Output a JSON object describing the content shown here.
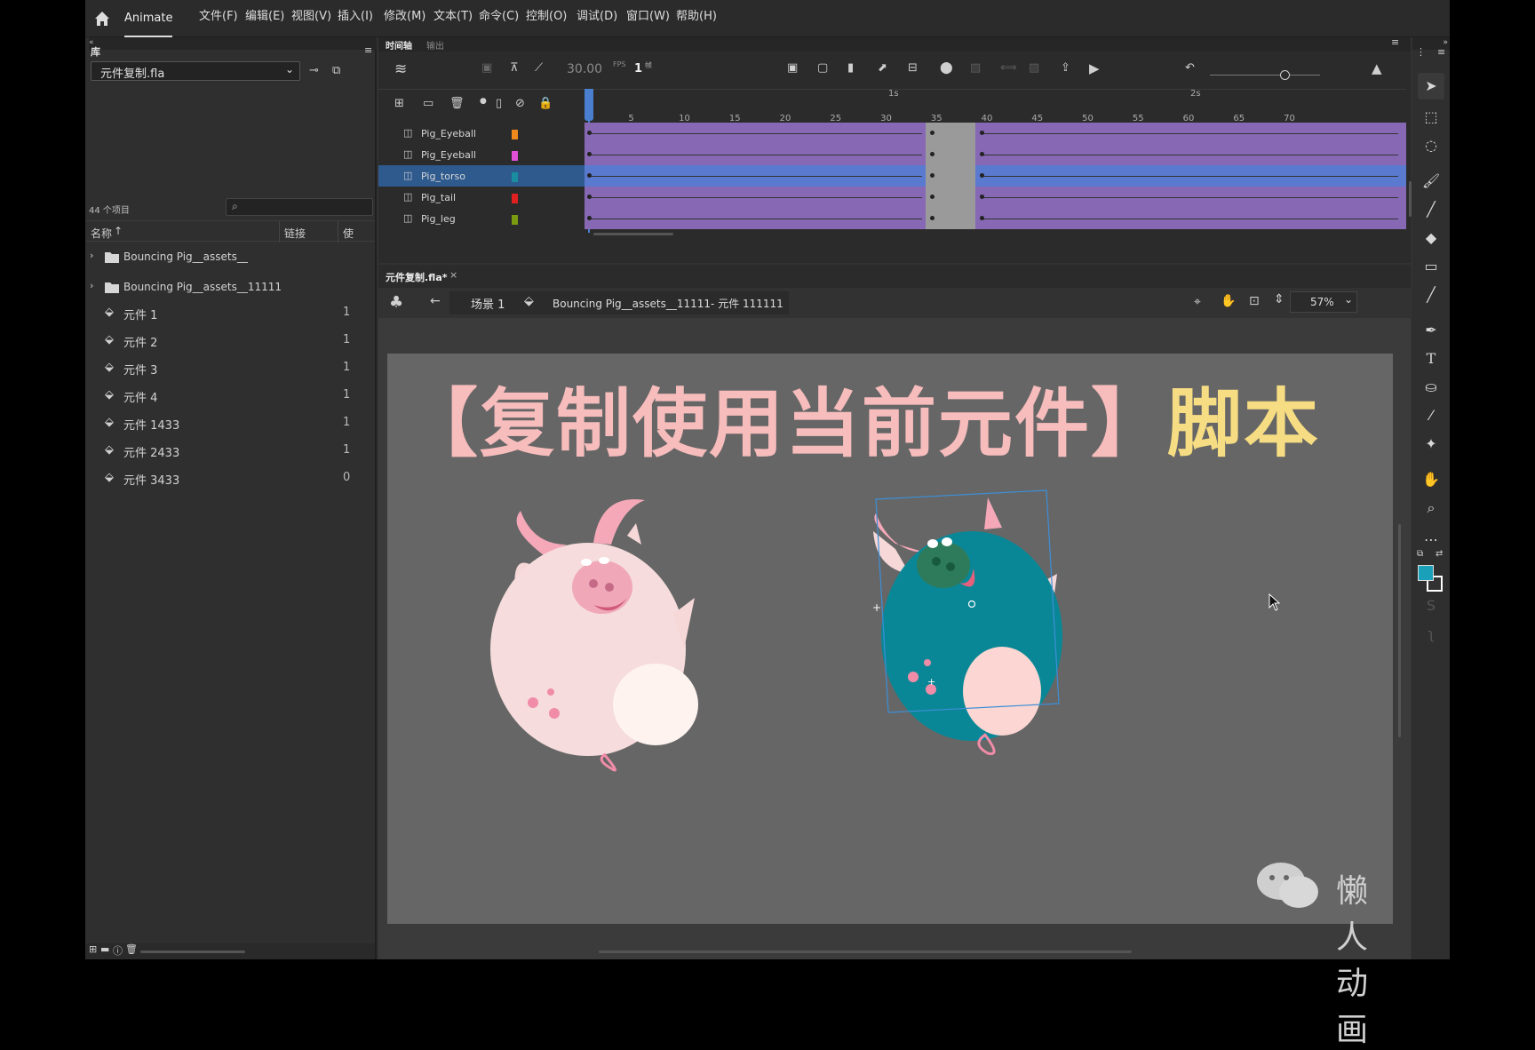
{
  "app": {
    "name": "Animate"
  },
  "menu": [
    "文件(F)",
    "编辑(E)",
    "视图(V)",
    "插入(I)",
    "修改(M)",
    "文本(T)",
    "命令(C)",
    "控制(O)",
    "调试(D)",
    "窗口(W)",
    "帮助(H)"
  ],
  "library": {
    "tab": "库",
    "file": "元件复制.fla",
    "count": "44 个项目",
    "col_name": "名称",
    "col_link": "链接",
    "col_use": "使",
    "items": [
      {
        "label": "Bouncing Pig__assets__",
        "type": "folder",
        "count": ""
      },
      {
        "label": "Bouncing Pig__assets__11111",
        "type": "folder",
        "count": ""
      },
      {
        "label": "元件 1",
        "type": "symbol",
        "count": "1"
      },
      {
        "label": "元件 2",
        "type": "symbol",
        "count": "1"
      },
      {
        "label": "元件 3",
        "type": "symbol",
        "count": "1"
      },
      {
        "label": "元件 4",
        "type": "symbol",
        "count": "1"
      },
      {
        "label": "元件 1433",
        "type": "symbol",
        "count": "1"
      },
      {
        "label": "元件 2433",
        "type": "symbol",
        "count": "1"
      },
      {
        "label": "元件 3433",
        "type": "symbol",
        "count": "0"
      }
    ]
  },
  "timeline": {
    "tab_timeline": "时间轴",
    "tab_output": "输出",
    "fps": "30.00",
    "fps_unit": "FPS",
    "frame": "1",
    "frame_unit": "帧",
    "sec1": "1s",
    "sec2": "2s",
    "ticks": [
      "5",
      "10",
      "15",
      "20",
      "25",
      "30",
      "35",
      "40",
      "45",
      "50",
      "55",
      "60",
      "65",
      "70"
    ],
    "layers": [
      {
        "name": "Pig_Eyeball",
        "color": "#f08a1c",
        "selected": false
      },
      {
        "name": "Pig_Eyeball",
        "color": "#e050d8",
        "selected": false
      },
      {
        "name": "Pig_torso",
        "color": "#1a8ea0",
        "selected": true
      },
      {
        "name": "Pig_tail",
        "color": "#e02020",
        "selected": false
      },
      {
        "name": "Pig_leg",
        "color": "#7a9a10",
        "selected": false
      }
    ]
  },
  "document": {
    "tab": "元件复制.fla*",
    "scene": "场景 1",
    "symbol_path": "Bouncing  Pig__assets__11111- 元件 111111",
    "zoom": "57%"
  },
  "stage": {
    "title_left": "【复制使用当前元件】",
    "title_right": "脚本",
    "watermark": "懒人动画",
    "pig_left_color": "#f6dcdc",
    "pig_right_color": "#0a8796"
  },
  "colors": {
    "stroke": "#1aa0b8",
    "fill": "#ffffff",
    "accent": "#4a7fd0"
  }
}
